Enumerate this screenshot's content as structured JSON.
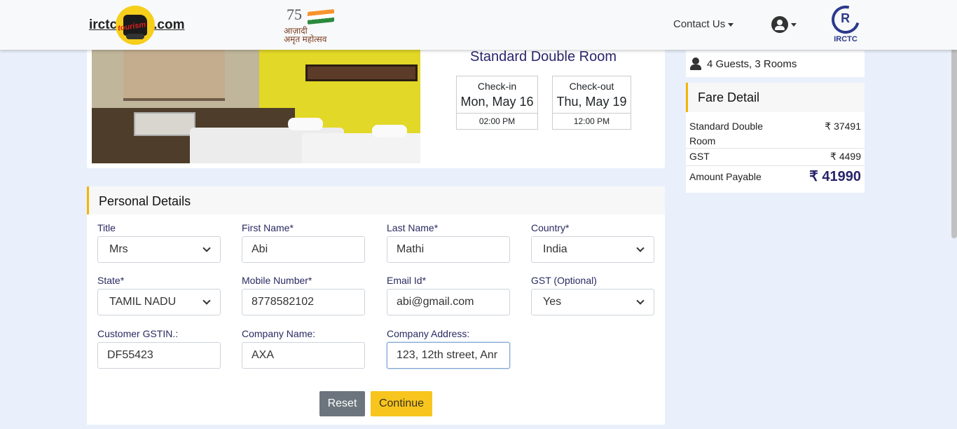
{
  "header": {
    "logo_left": "irctc",
    "logo_script": "tourism",
    "logo_right": ".com",
    "azadi_number": "75",
    "azadi_text_line1": "आज़ादी",
    "azadi_text_line2": "अमृत महोत्सव",
    "contact_label": "Contact Us",
    "irctc_logo_text": "IRCTC",
    "irctc_mark": "R"
  },
  "room": {
    "title": "Standard Double Room",
    "checkin_label": "Check-in",
    "checkin_date": "Mon, May 16",
    "checkin_time": "02:00 PM",
    "checkout_label": "Check-out",
    "checkout_date": "Thu, May 19",
    "checkout_time": "12:00 PM"
  },
  "personal": {
    "heading": "Personal Details",
    "title_label": "Title",
    "title_value": "Mrs",
    "first_name_label": "First Name*",
    "first_name_value": "Abi",
    "last_name_label": "Last Name*",
    "last_name_value": "Mathi",
    "country_label": "Country*",
    "country_value": "India",
    "state_label": "State*",
    "state_value": "TAMIL NADU",
    "mobile_label": "Mobile Number*",
    "mobile_value": "8778582102",
    "email_label": "Email Id*",
    "email_value": "abi@gmail.com",
    "gst_label": "GST (Optional)",
    "gst_value": "Yes",
    "gstin_label": "Customer GSTIN.:",
    "gstin_value": "DF55423",
    "company_name_label": "Company Name:",
    "company_name_value": "AXA",
    "company_address_label": "Company Address:",
    "company_address_value": "123, 12th street, Anr",
    "reset_label": "Reset",
    "continue_label": "Continue"
  },
  "summary": {
    "guests": "4 Guests, 3 Rooms"
  },
  "fare": {
    "heading": "Fare Detail",
    "room_label_line1": "Standard Double",
    "room_label_line2": "Room",
    "room_amount": "₹ 37491",
    "gst_label": "GST",
    "gst_amount": "₹ 4499",
    "payable_label": "Amount Payable",
    "payable_amount": "₹ 41990"
  },
  "colors": {
    "accent_yellow": "#f7c51d",
    "brand_navy": "#28256b",
    "page_bg": "#e9f0fb"
  }
}
